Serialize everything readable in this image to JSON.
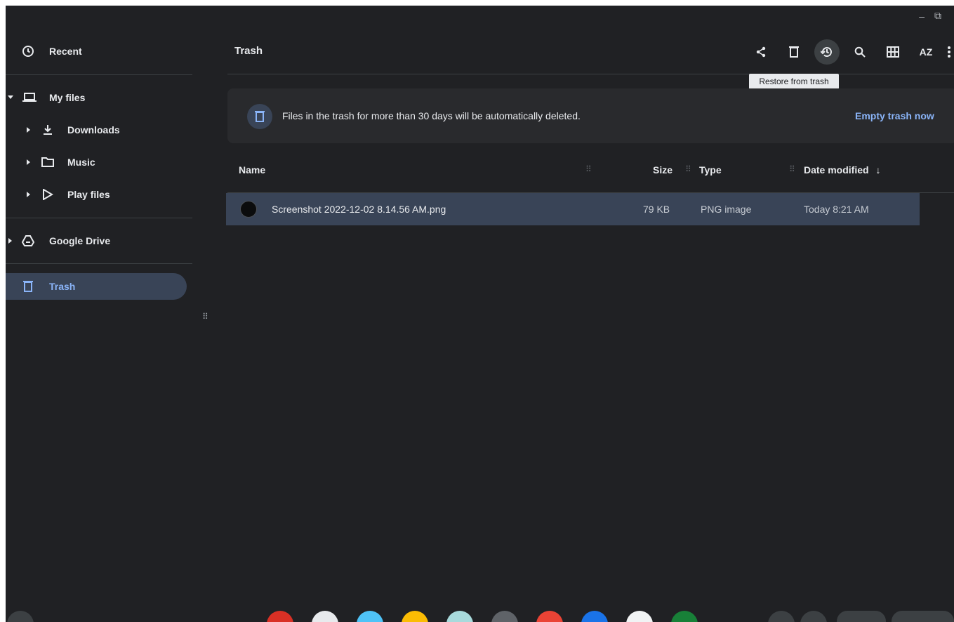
{
  "window": {
    "minimize_glyph": "–",
    "restore_glyph": "⧉"
  },
  "sidebar": {
    "items": [
      {
        "label": "Recent",
        "icon": "clock-icon"
      },
      {
        "label": "My files",
        "icon": "laptop-icon",
        "expanded": true
      },
      {
        "label": "Downloads",
        "icon": "download-icon"
      },
      {
        "label": "Music",
        "icon": "folder-icon"
      },
      {
        "label": "Play files",
        "icon": "play-store-icon"
      },
      {
        "label": "Google Drive",
        "icon": "drive-icon"
      },
      {
        "label": "Trash",
        "icon": "trash-icon",
        "selected": true
      }
    ]
  },
  "toolbar": {
    "title": "Trash",
    "buttons": [
      {
        "name": "share",
        "icon": "share-icon"
      },
      {
        "name": "delete",
        "icon": "trash-icon"
      },
      {
        "name": "restore",
        "icon": "restore-icon"
      },
      {
        "name": "search",
        "icon": "search-icon"
      },
      {
        "name": "grid-view",
        "icon": "grid-icon"
      },
      {
        "name": "sort",
        "icon": "sort-az-icon",
        "label": "AZ"
      },
      {
        "name": "more",
        "icon": "more-vert-icon"
      }
    ],
    "tooltip": "Restore from trash"
  },
  "banner": {
    "message": "Files in the trash for more than 30 days will be automatically deleted.",
    "action": "Empty trash now"
  },
  "table": {
    "columns": [
      "Name",
      "Size",
      "Type",
      "Date modified"
    ],
    "sort_indicator": "↓",
    "rows": [
      {
        "name": "Screenshot 2022-12-02 8.14.56 AM.png",
        "size": "79 KB",
        "type": "PNG image",
        "date": "Today 8:21 AM"
      }
    ]
  },
  "colors": {
    "background": "#202124",
    "selected": "#394457",
    "accent": "#8ab4f8",
    "banner": "#292a2d"
  }
}
